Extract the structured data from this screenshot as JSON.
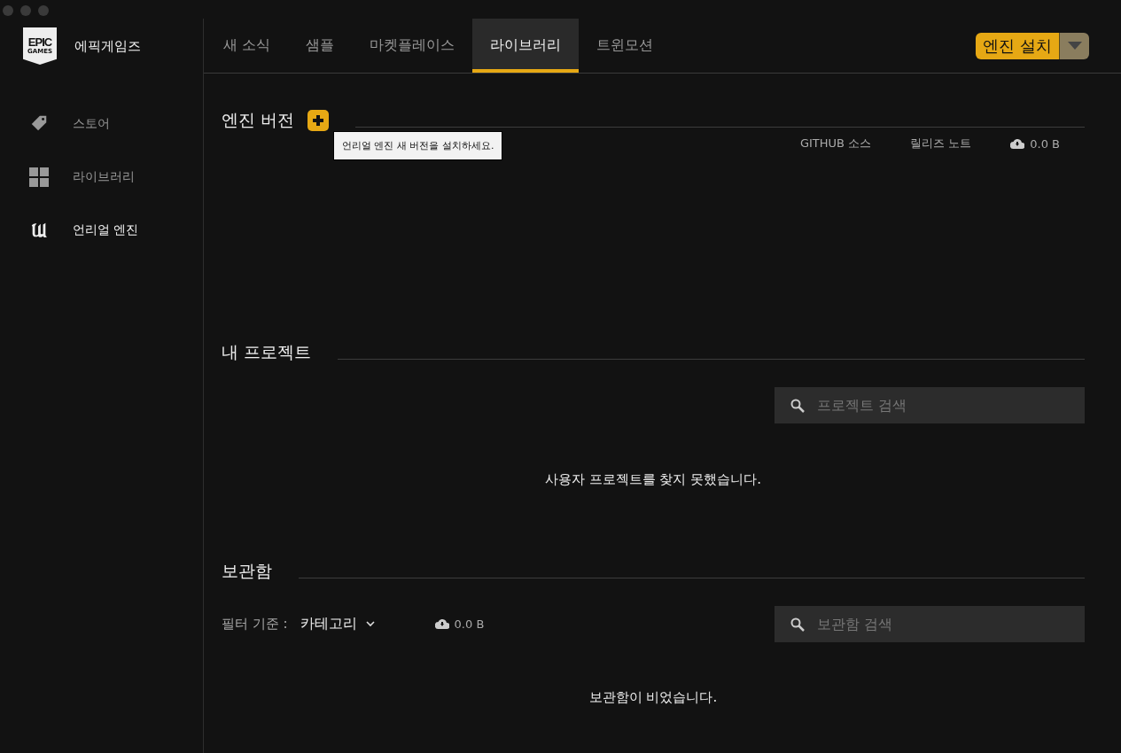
{
  "brand": {
    "logo_top": "EPIC",
    "logo_bottom": "GAMES",
    "name": "에픽게임즈"
  },
  "sidebar": {
    "items": [
      {
        "label": "스토어",
        "kind": "tag",
        "selected": false
      },
      {
        "label": "라이브러리",
        "kind": "grid",
        "selected": false
      },
      {
        "label": "언리얼 엔진",
        "kind": "unreal",
        "selected": true
      }
    ]
  },
  "tabs": [
    {
      "label": "새 소식",
      "selected": false
    },
    {
      "label": "샘플",
      "selected": false
    },
    {
      "label": "마켓플레이스",
      "selected": false
    },
    {
      "label": "라이브러리",
      "selected": true
    },
    {
      "label": "트윈모션",
      "selected": false
    }
  ],
  "install_button": {
    "label": "엔진 설치"
  },
  "engine_versions": {
    "title": "엔진 버전",
    "tooltip": "언리얼 엔진 새 버전을 설치하세요.",
    "links": [
      "GITHUB 소스",
      "릴리즈 노트"
    ],
    "size": "0.0 B"
  },
  "projects": {
    "title": "내 프로젝트",
    "search_placeholder": "프로젝트 검색",
    "empty": "사용자 프로젝트를 찾지 못했습니다."
  },
  "vault": {
    "title": "보관함",
    "filter_label": "필터 기준 :",
    "filter_value": "카테고리",
    "size": "0.0 B",
    "search_placeholder": "보관함 검색",
    "empty": "보관함이 비었습니다."
  }
}
